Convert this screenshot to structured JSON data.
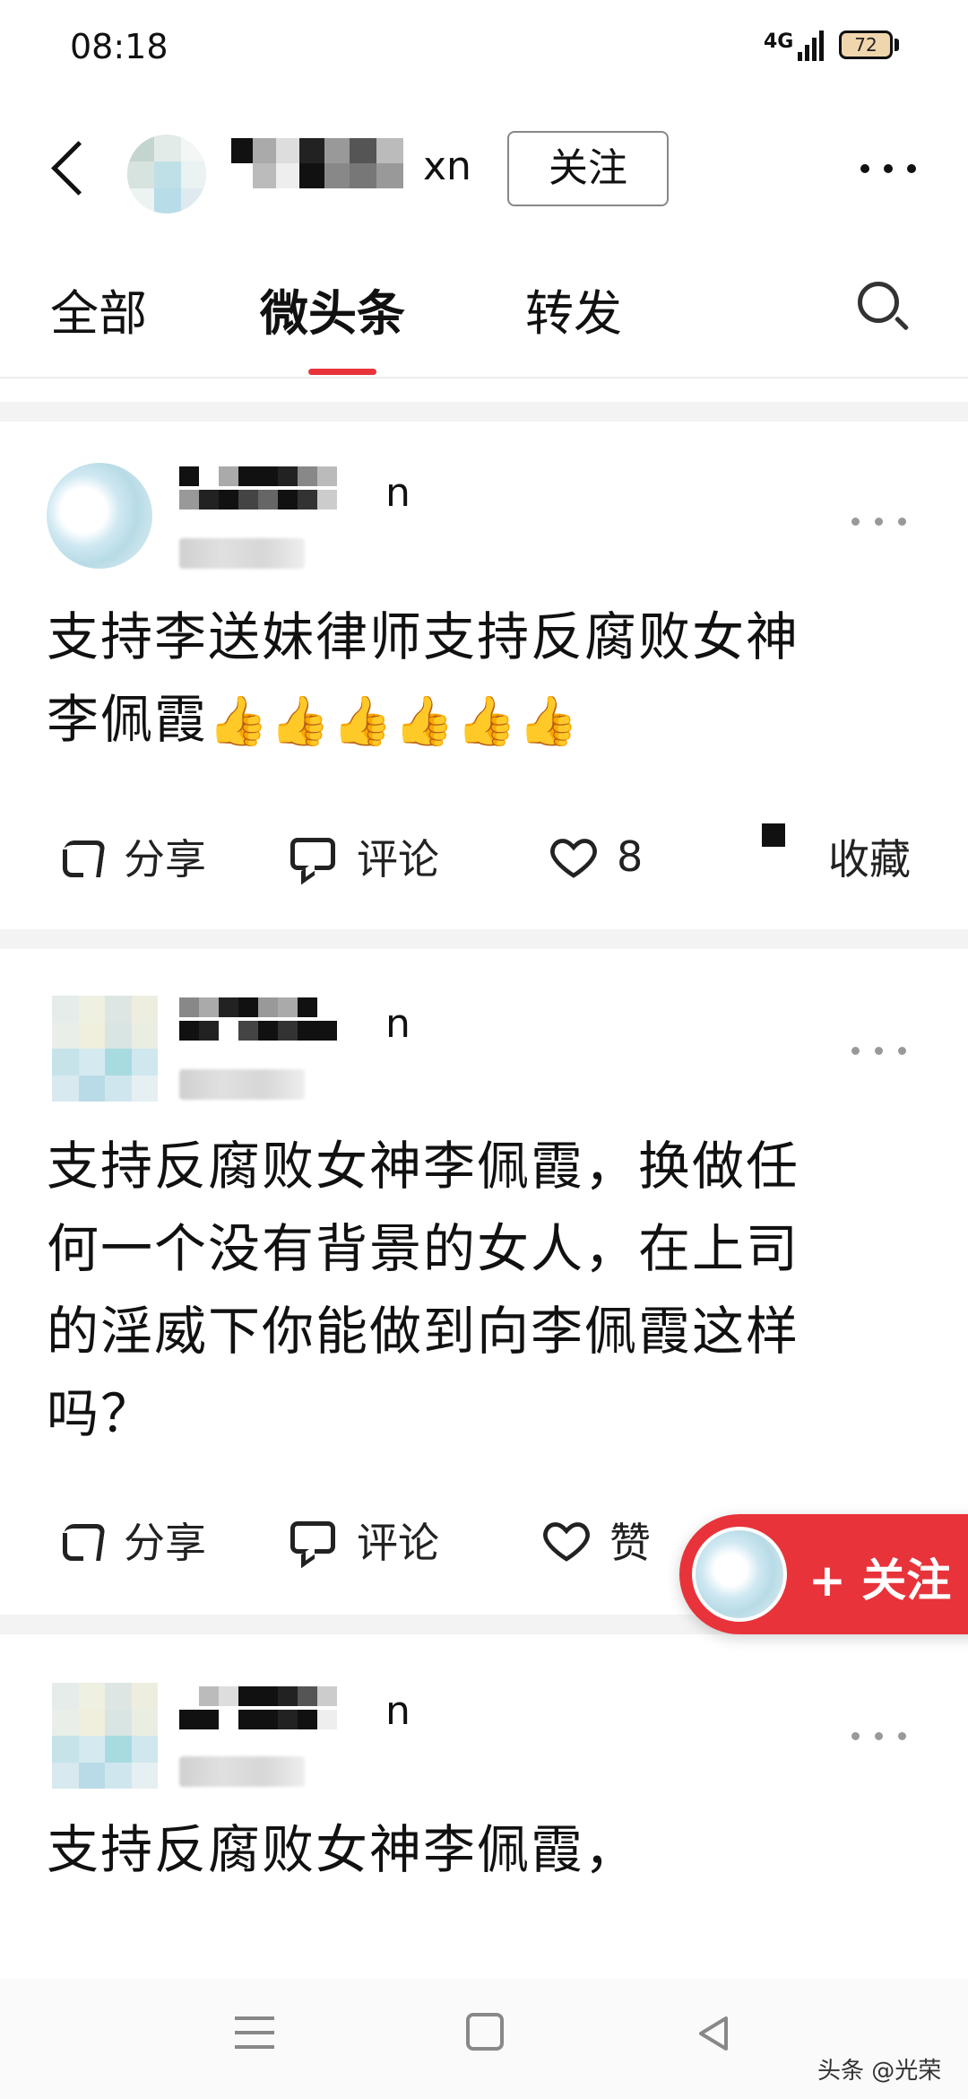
{
  "status_bar": {
    "time": "08:18",
    "network": "4G",
    "battery": "72"
  },
  "header": {
    "username_suffix": "xn",
    "follow_label": "关注"
  },
  "tabs": [
    {
      "label": "全部"
    },
    {
      "label": "微头条"
    },
    {
      "label": "转发"
    }
  ],
  "posts": [
    {
      "username_suffix": "n",
      "text_line1": "支持李送妹律师支持反腐败女神",
      "text_line2": "李佩霞",
      "thumbs": "👍👍👍👍👍👍",
      "share_label": "分享",
      "comment_label": "评论",
      "like_label": "8",
      "collect_label": "收藏"
    },
    {
      "username_suffix": "n",
      "text_lines": [
        "支持反腐败女神李佩霞，换做任",
        "何一个没有背景的女人，在上司",
        "的淫威下你能做到向李佩霞这样",
        "吗？"
      ],
      "share_label": "分享",
      "comment_label": "评论",
      "like_label": "赞"
    },
    {
      "username_suffix": "n",
      "text": "支持反腐败女神李佩霞，"
    }
  ],
  "fab": {
    "label": "+ 关注"
  },
  "watermark": "头条 @光荣"
}
